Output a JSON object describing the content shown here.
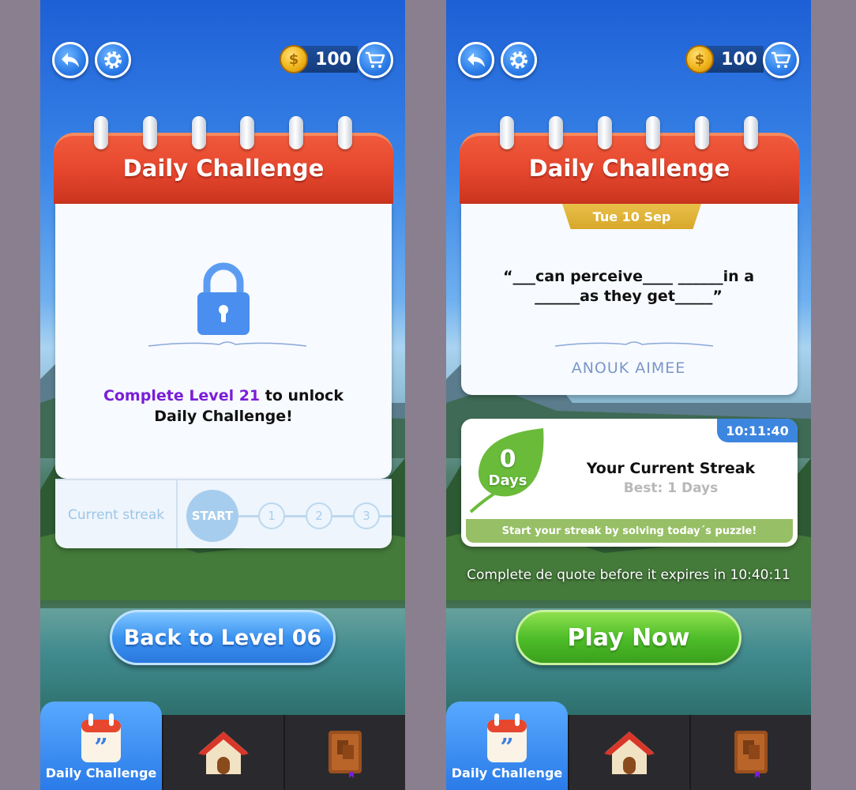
{
  "left": {
    "coins": "100",
    "calendar_title": "Daily Challenge",
    "unlock_highlight": "Complete Level 21",
    "unlock_rest": " to unlock",
    "unlock_line2": "Daily Challenge!",
    "streak_label": "Current streak",
    "streak_start": "START",
    "streak_steps": [
      "1",
      "2",
      "3"
    ],
    "back_button": "Back to Level 06"
  },
  "right": {
    "coins": "100",
    "calendar_title": "Daily Challenge",
    "date": "Tue 10 Sep",
    "quote_line1": "“___can perceive____ ______in a",
    "quote_line2": "______as they get_____”",
    "author": "ANOUK AIMEE",
    "timer": "10:11:40",
    "streak_num": "0",
    "streak_unit": "Days",
    "streak_title": "Your Current Streak",
    "streak_best": "Best: 1 Days",
    "streak_hint": "Start your streak by solving today´s puzzle!",
    "expire_text": "Complete de quote before it expires in 10:40:11",
    "play_button": "Play Now"
  },
  "nav": {
    "daily_label": "Daily Challenge"
  },
  "colors": {
    "calendar_red": "#e6472e",
    "highlight_purple": "#7a1ed8",
    "play_green": "#4fbe2a",
    "button_blue": "#3b93f0",
    "date_gold": "#d7a72a"
  }
}
